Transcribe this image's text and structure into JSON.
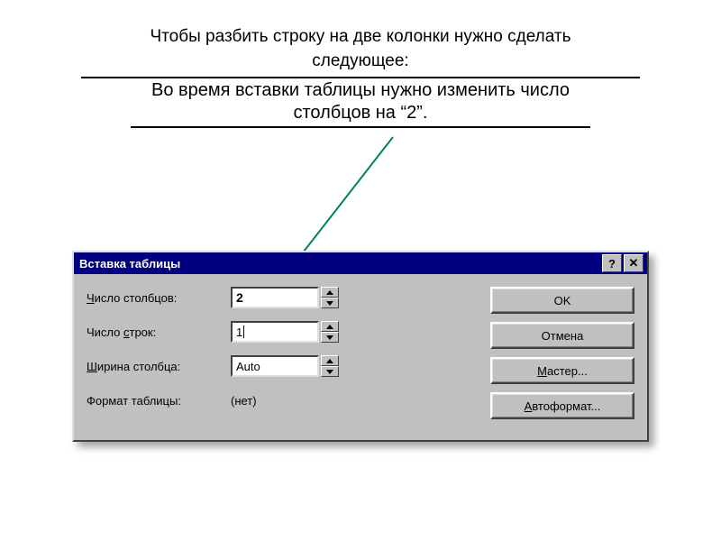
{
  "heading": {
    "line1": "Чтобы разбить строку на две колонки нужно сделать",
    "line2": "следующее:",
    "sub1": "Во время вставки таблицы нужно изменить число",
    "sub2": "столбцов на “2”."
  },
  "dialog": {
    "title": "Вставка таблицы",
    "help_btn": "?",
    "close_btn": "✕",
    "fields": {
      "cols_label_pre": "Ч",
      "cols_label_rest": "исло столбцов:",
      "cols_value": "2",
      "rows_label_pre": "Число ",
      "rows_label_ul": "с",
      "rows_label_rest": "трок:",
      "rows_value": "1",
      "width_label_pre": "Ш",
      "width_label_rest": "ирина столбца:",
      "width_value": "Auto",
      "format_label": "Формат таблицы:",
      "format_value": "(нет)"
    },
    "buttons": {
      "ok": "OK",
      "cancel": "Отмена",
      "wizard_pre": "М",
      "wizard_rest": "астер...",
      "autoformat_pre": "А",
      "autoformat_rest": "втоформат..."
    }
  }
}
